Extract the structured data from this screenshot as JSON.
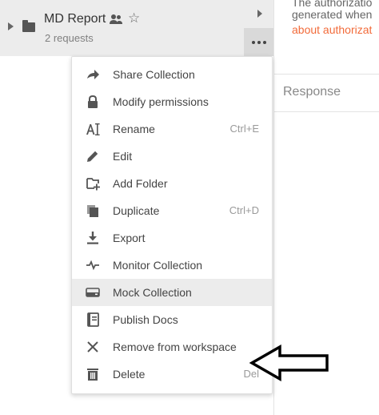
{
  "collection": {
    "title": "MD Report",
    "subtitle": "2 requests"
  },
  "right_pane": {
    "line1": "The authorizatio",
    "line2": "generated when",
    "link": "about authorizat",
    "response_label": "Response"
  },
  "menu": {
    "items": [
      {
        "label": "Share Collection",
        "shortcut": "",
        "icon": "share-arrow-icon"
      },
      {
        "label": "Modify permissions",
        "shortcut": "",
        "icon": "lock-icon"
      },
      {
        "label": "Rename",
        "shortcut": "Ctrl+E",
        "icon": "rename-icon"
      },
      {
        "label": "Edit",
        "shortcut": "",
        "icon": "pencil-icon"
      },
      {
        "label": "Add Folder",
        "shortcut": "",
        "icon": "add-folder-icon"
      },
      {
        "label": "Duplicate",
        "shortcut": "Ctrl+D",
        "icon": "duplicate-icon"
      },
      {
        "label": "Export",
        "shortcut": "",
        "icon": "export-icon"
      },
      {
        "label": "Monitor Collection",
        "shortcut": "",
        "icon": "monitor-icon"
      },
      {
        "label": "Mock Collection",
        "shortcut": "",
        "icon": "mock-server-icon"
      },
      {
        "label": "Publish Docs",
        "shortcut": "",
        "icon": "docs-icon"
      },
      {
        "label": "Remove from workspace",
        "shortcut": "",
        "icon": "close-icon"
      },
      {
        "label": "Delete",
        "shortcut": "Del",
        "icon": "trash-icon"
      }
    ],
    "highlighted_index": 8
  },
  "colors": {
    "link": "#f26b3a",
    "header_bg": "#ececec",
    "highlight_bg": "#ececec"
  }
}
